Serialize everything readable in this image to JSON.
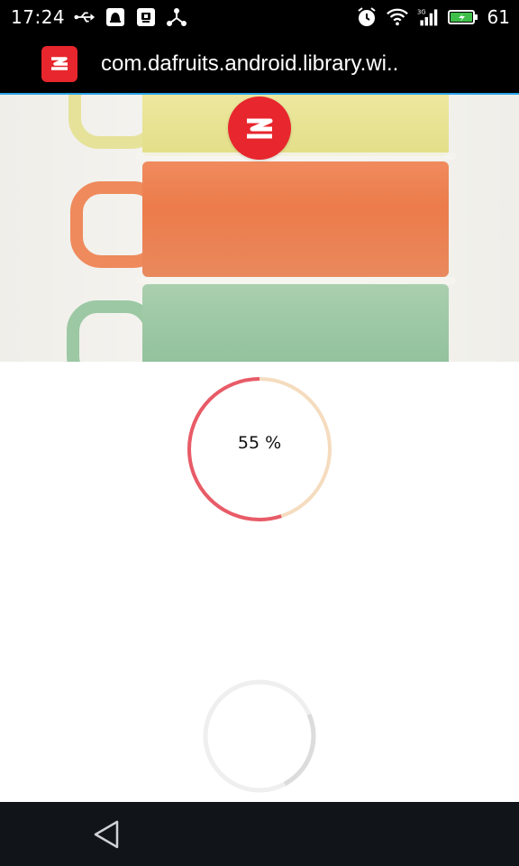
{
  "status_bar": {
    "time": "17:24",
    "battery_level": "61",
    "left_icons": [
      "usb-icon",
      "notification-icon",
      "screenshot-icon",
      "share-icon"
    ],
    "right_icons": [
      "alarm-icon",
      "wifi-icon",
      "signal-3g-icon",
      "battery-icon"
    ],
    "network_label": "3G"
  },
  "app_bar": {
    "title": "com.dafruits.android.library.wi..",
    "icon": "app-logo-icon",
    "brand_color": "#e8262d"
  },
  "hero": {
    "image": "stacked-cups-photo",
    "badge_icon": "app-logo-icon"
  },
  "progress": {
    "value_percent": 55,
    "label": "55 %",
    "progress_color": "#e85b68",
    "track_color": "#f5dcbf"
  },
  "spinner": {
    "track_color": "#efefef",
    "arc_color": "#dcdcdc"
  },
  "nav_bar": {
    "back_icon": "back-triangle-icon"
  }
}
